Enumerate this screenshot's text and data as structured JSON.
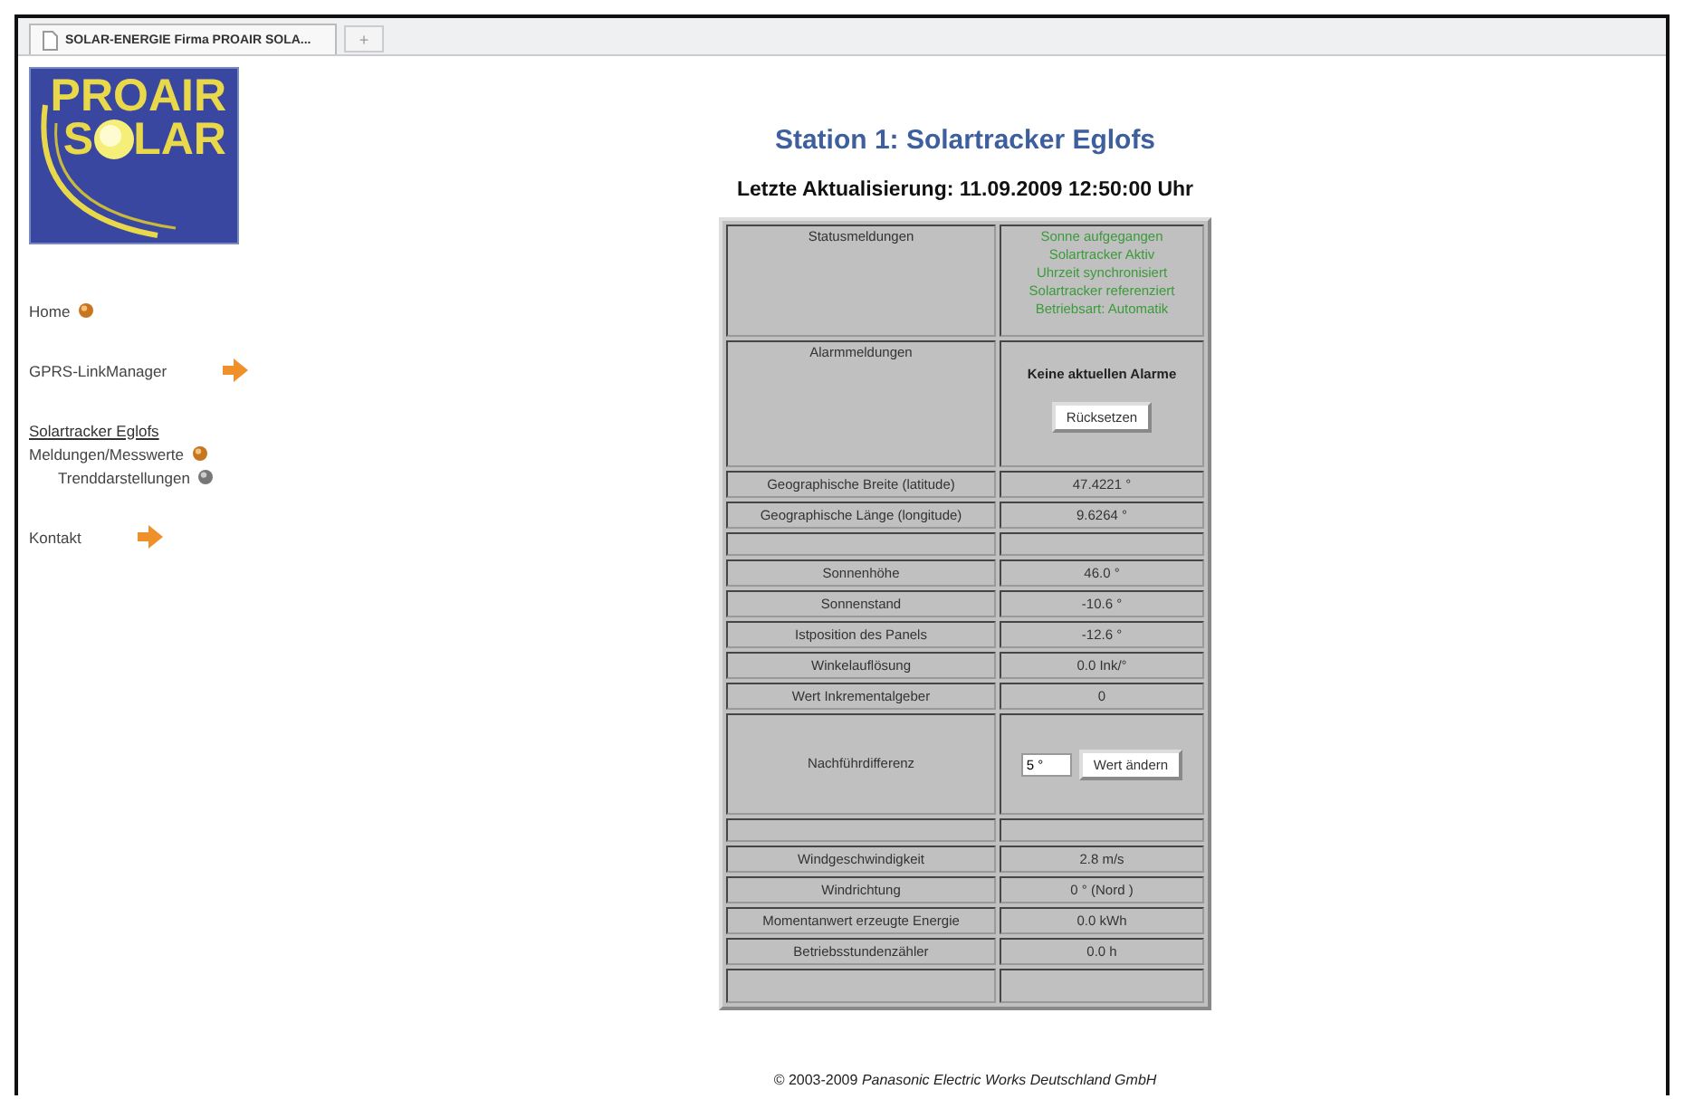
{
  "browser_tab": {
    "title": "SOLAR-ENERGIE Firma PROAIR SOLA...",
    "new_tab": "+"
  },
  "logo": {
    "line1": "PROAIR",
    "line2_start": "S",
    "line2_end": "LAR"
  },
  "sidebar": {
    "items": [
      {
        "label": "Home",
        "kind": "ball"
      },
      {
        "label": "GPRS-LinkManager",
        "kind": "arrow"
      },
      {
        "label": "Solartracker Eglofs",
        "kind": "heading",
        "children": [
          {
            "label": "Meldungen/Messwerte",
            "kind": "ball",
            "children": [
              {
                "label": "Trenddarstellungen",
                "kind": "grayball"
              }
            ]
          }
        ]
      },
      {
        "label": "Kontakt",
        "kind": "arrow"
      }
    ]
  },
  "title": "Station 1: Solartracker Eglofs",
  "last_update": "Letzte Aktualisierung: 11.09.2009 12:50:00 Uhr",
  "table": {
    "rows": [
      {
        "kind": "status",
        "label": "Statusmeldungen",
        "lines": [
          "Sonne aufgegangen",
          "Solartracker Aktiv",
          "Uhrzeit synchronisiert",
          "Solartracker referenziert",
          "Betriebsart: Automatik"
        ]
      },
      {
        "kind": "alarm",
        "label": "Alarmmeldungen",
        "message": "Keine aktuellen Alarme",
        "button": "Rücksetzen"
      },
      {
        "kind": "text",
        "label": "Geographische Breite (latitude)",
        "value": "47.4221 °"
      },
      {
        "kind": "text",
        "label": "Geographische Länge (longitude)",
        "value": "9.6264 °"
      },
      {
        "kind": "empty"
      },
      {
        "kind": "text",
        "label": "Sonnenhöhe",
        "value": "46.0 °"
      },
      {
        "kind": "text",
        "label": "Sonnenstand",
        "value": "-10.6 °"
      },
      {
        "kind": "text",
        "label": "Istposition des Panels",
        "value": "-12.6 °"
      },
      {
        "kind": "text",
        "label": "Winkelauflösung",
        "value": "0.0 Ink/°"
      },
      {
        "kind": "text",
        "label": "Wert Inkrementalgeber",
        "value": "0"
      },
      {
        "kind": "input",
        "label": "Nachführdifferenz",
        "value": "5 °",
        "button": "Wert ändern"
      },
      {
        "kind": "empty"
      },
      {
        "kind": "text",
        "label": "Windgeschwindigkeit",
        "value": "2.8 m/s"
      },
      {
        "kind": "text",
        "label": "Windrichtung",
        "value": "0 ° (Nord )"
      },
      {
        "kind": "text",
        "label": "Momentanwert erzeugte Energie",
        "value": "0.0 kWh"
      },
      {
        "kind": "text",
        "label": "Betriebsstundenzähler",
        "value": "0.0 h"
      },
      {
        "kind": "empty"
      }
    ]
  },
  "footer": "© 2003-2009 *Panasonic Electric Works Deutschland GmbH*"
}
